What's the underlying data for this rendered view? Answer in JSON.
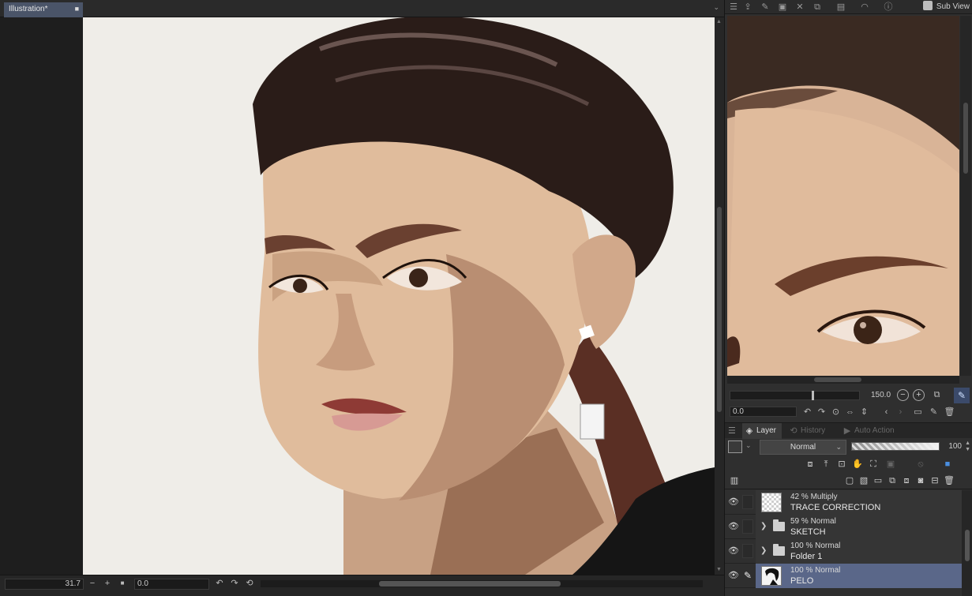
{
  "canvas": {
    "tab_title": "Illustration*",
    "tab_close": "■",
    "tab_menu": "⌄"
  },
  "status": {
    "zoom": "31.7",
    "minus": "−",
    "plus": "+",
    "fit": "■",
    "angle": "0.0",
    "rotate_left": "↶",
    "rotate_right": "↷",
    "reset": "⟲"
  },
  "subview": {
    "button_label": "Sub View",
    "zoom": "150.0",
    "rotation": "0.0"
  },
  "layer_panel": {
    "tabs": [
      {
        "label": "Layer",
        "icon": "layers-icon",
        "active": true
      },
      {
        "label": "History",
        "icon": "history-icon",
        "active": false
      },
      {
        "label": "Auto Action",
        "icon": "auto-action-icon",
        "active": false
      }
    ],
    "blend_mode": "Normal",
    "opacity": 100,
    "opacity_label": "100",
    "layers": [
      {
        "mode": "42 % Multiply",
        "name": "TRACE CORRECTION",
        "type": "raster",
        "selected": false
      },
      {
        "mode": "59 % Normal",
        "name": "SKETCH",
        "type": "folder",
        "selected": false
      },
      {
        "mode": "100 % Normal",
        "name": "Folder 1",
        "type": "folder",
        "selected": false
      },
      {
        "mode": "100 % Normal",
        "name": "PELO",
        "type": "raster",
        "selected": true
      }
    ]
  },
  "colors": {
    "accent_tab": "#4a5468",
    "selected_layer": "#5a6789",
    "canvas_paper": "#efede8",
    "panel_bg": "#2f2f2f"
  }
}
